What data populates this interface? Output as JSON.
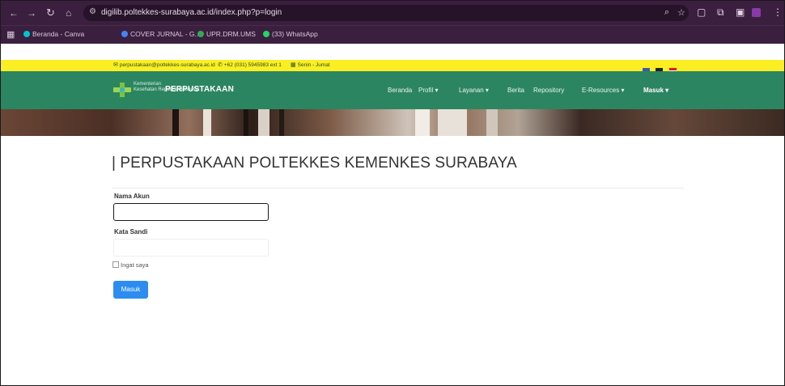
{
  "browser": {
    "url": "digilib.poltekkes-surabaya.ac.id/index.php?p=login",
    "bookmarks": [
      {
        "label": "Beranda - Canva",
        "color": "#00c4cc"
      },
      {
        "label": "COVER JURNAL - G...",
        "color": "#4285f4"
      },
      {
        "label": "UPR.DRM.UMS",
        "color": "#34a853"
      },
      {
        "label": "(33) WhatsApp",
        "color": "#25d366"
      }
    ]
  },
  "site": {
    "topbar": {
      "email": "perpustakaan@poltekkes-surabaya.ac.id",
      "phone": "+62 (031) 5945983 ext 1",
      "hours": "Senin - Jumat"
    },
    "brand": {
      "logo_line1": "Kementerian",
      "logo_line2": "Kesehatan Republik Indonesia",
      "title": "PERPUSTAKAAN"
    },
    "menu": [
      {
        "label": "Beranda"
      },
      {
        "label": "Profil ▾"
      },
      {
        "label": "Layanan ▾"
      },
      {
        "label": "Berita"
      },
      {
        "label": "Repository"
      },
      {
        "label": "E-Resources ▾"
      },
      {
        "label": "Masuk ▾"
      }
    ],
    "colors": {
      "topbar": "#fbee23",
      "navbar": "#2c8561",
      "button": "#2d8cf0"
    }
  },
  "login": {
    "title": "| PERPUSTAKAAN POLTEKKES KEMENKES SURABAYA",
    "username_label": "Nama Akun",
    "password_label": "Kata Sandi",
    "remember_label": "Ingat saya",
    "submit_label": "Masuk"
  }
}
